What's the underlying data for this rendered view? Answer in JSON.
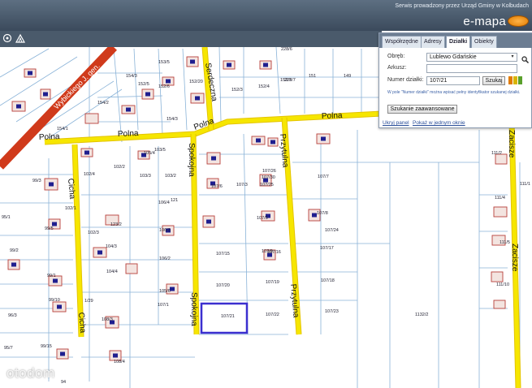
{
  "header": {
    "service_text": "Serwis prowadzony przez Urząd Gminy w Kolbudach",
    "brand": "e-mapa"
  },
  "toolbar": {
    "icons": [
      "layers-icon",
      "mountain-icon"
    ]
  },
  "panel": {
    "tabs": [
      {
        "label": "Współrzędne",
        "active": false
      },
      {
        "label": "Adresy",
        "active": false
      },
      {
        "label": "Działki",
        "active": true
      },
      {
        "label": "Obiekty",
        "active": false
      }
    ],
    "obreb_label": "Obręb:",
    "obreb_value": "Lublewo Gdańskie",
    "arkusz_label": "Arkusz:",
    "arkusz_value": "",
    "numer_label": "Numer działki:",
    "numer_value": "107/21",
    "search_button": "Szukaj",
    "hint": "W pole \"Numer działki\" można wpisać pełny identyfikator szukanej działki.",
    "advanced_button": "Szukanie zaawansowane",
    "hide_link": "Ukryj panel",
    "window_link": "Pokaż w jednym oknie",
    "swatch_colors": [
      "#e07b00",
      "#d8b400",
      "#5aa02c"
    ]
  },
  "map": {
    "street_names": {
      "main_road": "Wybickiego J. gen.",
      "polna_1": "Polna",
      "polna_2": "Polna",
      "polna_3": "Polna",
      "polna_4": "Polna",
      "spokojna_1": "Spokojna",
      "spokojna_2": "Spokojna",
      "serdeczna": "Serdeczna",
      "przytulna_1": "Przytulna",
      "przytulna_2": "Przytulna",
      "cicha_1": "Cicha",
      "cicha_2": "Cicha",
      "zacisze_1": "Zacisze",
      "zacisze_2": "Zacisze"
    },
    "parcel_labels": [
      "154/2",
      "154/3",
      "153/5",
      "152/6",
      "152/3",
      "152/4",
      "152/20",
      "152/7",
      "152/5",
      "154/3",
      "228/6",
      "228/7",
      "151",
      "149",
      "154/1",
      "102/4",
      "102/2",
      "103/3",
      "103/2",
      "103/5",
      "106/4",
      "106/3",
      "106/2",
      "107/6",
      "107/3",
      "107/26",
      "107/25",
      "107/5",
      "107/7",
      "107/8",
      "107/9",
      "107/15",
      "107/16",
      "107/17",
      "107/20",
      "107/19",
      "107/18",
      "107/21",
      "107/22",
      "107/23",
      "1132/2",
      "111/10",
      "111/1",
      "111/4",
      "111/5",
      "99/3",
      "99/5",
      "99/1",
      "99/15",
      "99/10",
      "96/3",
      "95/7",
      "95/1",
      "94",
      "99/2",
      "104/3",
      "104/4",
      "107/1",
      "108/4",
      "105/6",
      "108/3",
      "1/29",
      "121",
      "123/2",
      "111/2",
      "107/24",
      "107/30",
      "105/4",
      "102/1",
      "102/3"
    ],
    "selected_parcel": "107/21"
  },
  "watermark": "otodom"
}
